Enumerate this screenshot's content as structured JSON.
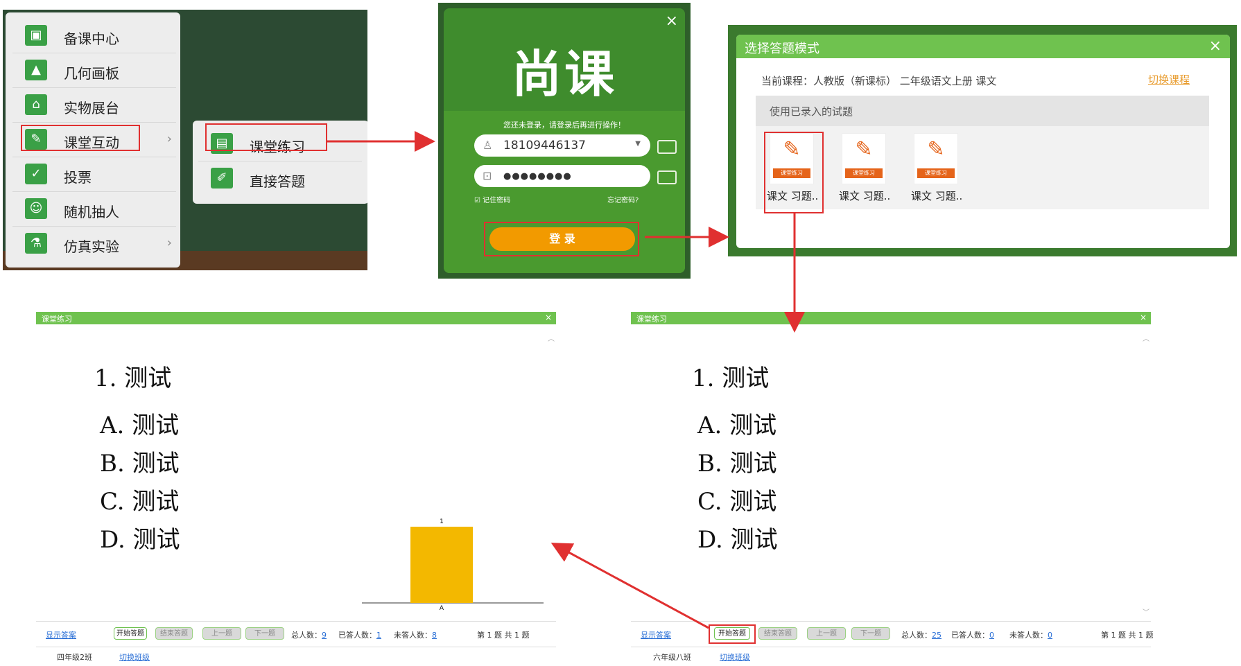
{
  "menu": {
    "items": [
      {
        "label": "备课中心",
        "icon": "book-icon"
      },
      {
        "label": "几何画板",
        "icon": "geometry-icon"
      },
      {
        "label": "实物展台",
        "icon": "document-camera-icon"
      },
      {
        "label": "课堂互动",
        "icon": "interaction-icon",
        "has_submenu": true
      },
      {
        "label": "投票",
        "icon": "vote-icon"
      },
      {
        "label": "随机抽人",
        "icon": "people-icon"
      },
      {
        "label": "仿真实验",
        "icon": "flask-icon",
        "has_submenu": true
      }
    ],
    "submenu": [
      {
        "label": "课堂练习",
        "icon": "document-icon"
      },
      {
        "label": "直接答题",
        "icon": "pencil-icon"
      }
    ]
  },
  "login": {
    "logo": "尚课",
    "notice": "您还未登录，请登录后再进行操作！",
    "username": "18109446137",
    "password_mask": "●●●●●●●●",
    "remember": "记住密码",
    "forgot": "忘记密码?",
    "login_button": "登 录",
    "close": "×"
  },
  "mode_dialog": {
    "title": "选择答题模式",
    "close": "×",
    "current_course": "当前课程：人教版（新课标） 二年级语文上册 课文",
    "switch_course": "切换课程",
    "section": "使用已录入的试题",
    "cards": [
      {
        "tag": "课堂练习",
        "label": "课文 习题.."
      },
      {
        "tag": "课堂练习",
        "label": "课文 习题.."
      },
      {
        "tag": "课堂练习",
        "label": "课文 习题.."
      }
    ]
  },
  "exercise_left": {
    "title": "课堂练习",
    "close": "×",
    "question": "1.  测试",
    "options": [
      "A. 测试",
      "B. 测试",
      "C. 测试",
      "D. 测试"
    ],
    "show_answer": "显示答案",
    "start": "开始答题",
    "end": "结束答题",
    "prev": "上一题",
    "next": "下一题",
    "total_label": "总人数：",
    "total": "9",
    "answered_label": "已答人数：",
    "answered": "1",
    "unanswered_label": "未答人数：",
    "unanswered": "8",
    "page": "第 1 题  共 1 题",
    "class_name": "四年级2班",
    "switch_class": "切换班级"
  },
  "exercise_right": {
    "title": "课堂练习",
    "close": "×",
    "question": "1.  测试",
    "options": [
      "A. 测试",
      "B. 测试",
      "C. 测试",
      "D. 测试"
    ],
    "show_answer": "显示答案",
    "start": "开始答题",
    "end": "结束答题",
    "prev": "上一题",
    "next": "下一题",
    "total_label": "总人数：",
    "total": "25",
    "answered_label": "已答人数：",
    "answered": "0",
    "unanswered_label": "未答人数：",
    "unanswered": "0",
    "page": "第 1 题  共 1 题",
    "class_name": "六年级八班",
    "switch_class": "切换班级"
  },
  "chart_data": {
    "type": "bar",
    "categories": [
      "A"
    ],
    "values": [
      1
    ],
    "ylim": [
      0,
      1
    ],
    "color": "#f3b800"
  },
  "colors": {
    "accent_green": "#6fc24f",
    "highlight_red": "#e03030",
    "login_orange": "#f29a00",
    "bar_yellow": "#f3b800"
  }
}
